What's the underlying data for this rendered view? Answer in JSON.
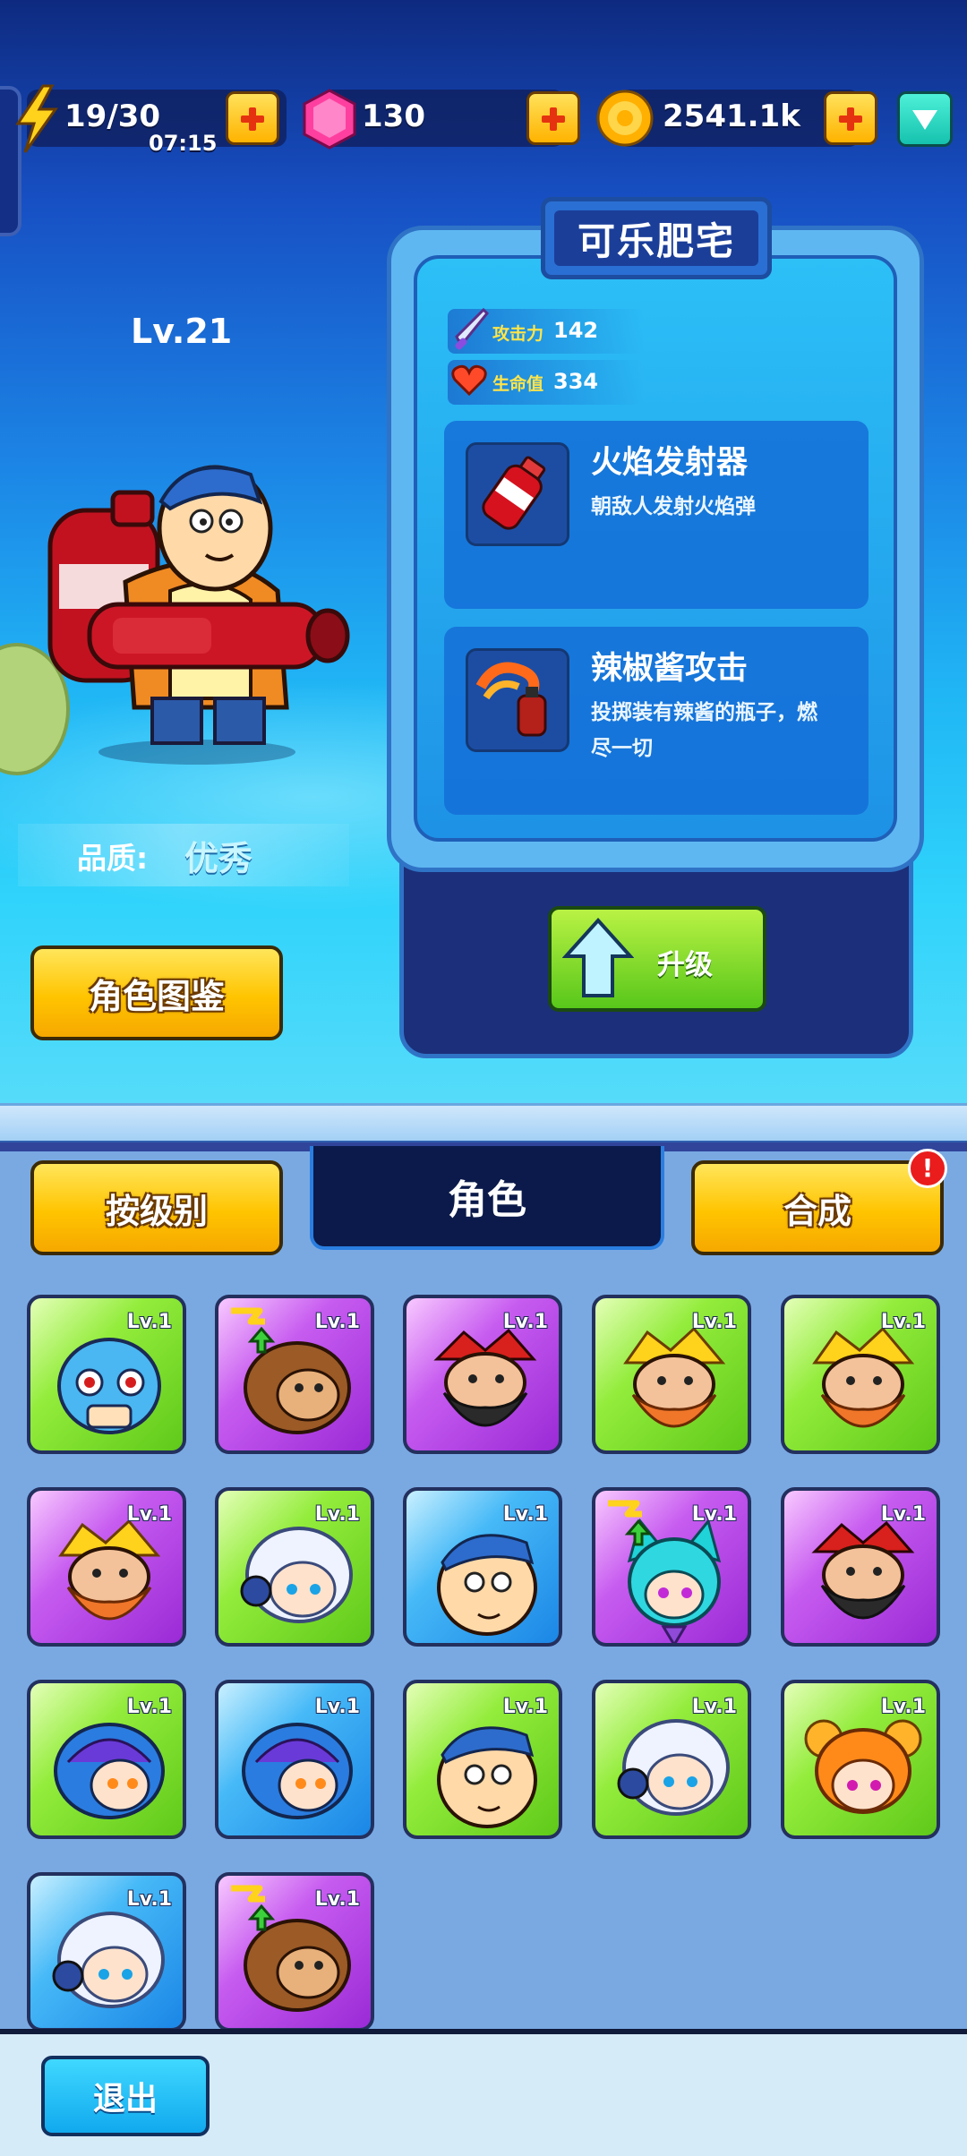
{
  "currency": {
    "energy": "19/30",
    "energy_timer": "07:15",
    "gems": "130",
    "coins": "2541.1k"
  },
  "hero": {
    "level": "Lv.21",
    "quality_label": "品质:",
    "quality_value": "优秀"
  },
  "detail": {
    "name": "可乐肥宅",
    "attack_label": "攻击力",
    "attack_value": "142",
    "hp_label": "生命值",
    "hp_value": "334",
    "skills": [
      {
        "name": "火焰发射器",
        "desc": "朝敌人发射火焰弹"
      },
      {
        "name": "辣椒酱攻击",
        "desc_line1": "投掷装有辣酱的瓶子，燃",
        "desc_line2": "尽一切"
      }
    ],
    "upgrade_label": "升级"
  },
  "buttons": {
    "codex": "角色图鉴",
    "sort": "按级别",
    "tab": "角色",
    "merge": "合成",
    "merge_badge": "!",
    "exit": "退出"
  },
  "roster": [
    {
      "lv": "Lv.1",
      "rarity": "green",
      "face": "blue-creature",
      "upgradable": false
    },
    {
      "lv": "Lv.1",
      "rarity": "purple",
      "face": "monkey",
      "upgradable": true
    },
    {
      "lv": "Lv.1",
      "rarity": "purple",
      "face": "black-beard",
      "upgradable": false
    },
    {
      "lv": "Lv.1",
      "rarity": "green",
      "face": "orange-beard",
      "upgradable": false
    },
    {
      "lv": "Lv.1",
      "rarity": "green",
      "face": "orange-beard",
      "upgradable": false
    },
    {
      "lv": "Lv.1",
      "rarity": "purple",
      "face": "orange-beard",
      "upgradable": false
    },
    {
      "lv": "Lv.1",
      "rarity": "green",
      "face": "silver-hair",
      "upgradable": false
    },
    {
      "lv": "Lv.1",
      "rarity": "blue",
      "face": "fat-guy",
      "upgradable": false
    },
    {
      "lv": "Lv.1",
      "rarity": "purple",
      "face": "cyan-cat-girl",
      "upgradable": true
    },
    {
      "lv": "Lv.1",
      "rarity": "purple",
      "face": "black-beard",
      "upgradable": false
    },
    {
      "lv": "Lv.1",
      "rarity": "green",
      "face": "hooded",
      "upgradable": false
    },
    {
      "lv": "Lv.1",
      "rarity": "blue",
      "face": "hooded",
      "upgradable": false
    },
    {
      "lv": "Lv.1",
      "rarity": "green",
      "face": "fat-guy",
      "upgradable": false
    },
    {
      "lv": "Lv.1",
      "rarity": "green",
      "face": "silver-hair",
      "upgradable": false
    },
    {
      "lv": "Lv.1",
      "rarity": "green",
      "face": "bun-girl",
      "upgradable": false
    },
    {
      "lv": "Lv.1",
      "rarity": "blue",
      "face": "silver-hair",
      "upgradable": false
    },
    {
      "lv": "Lv.1",
      "rarity": "purple",
      "face": "monkey",
      "upgradable": true
    }
  ],
  "colors": {
    "rarity_green": "#7bdc2a",
    "rarity_purple": "#b544e6",
    "rarity_blue": "#2aa2f0",
    "accent_yellow": "#ffc400",
    "upgrade_green": "#6fd11f"
  }
}
